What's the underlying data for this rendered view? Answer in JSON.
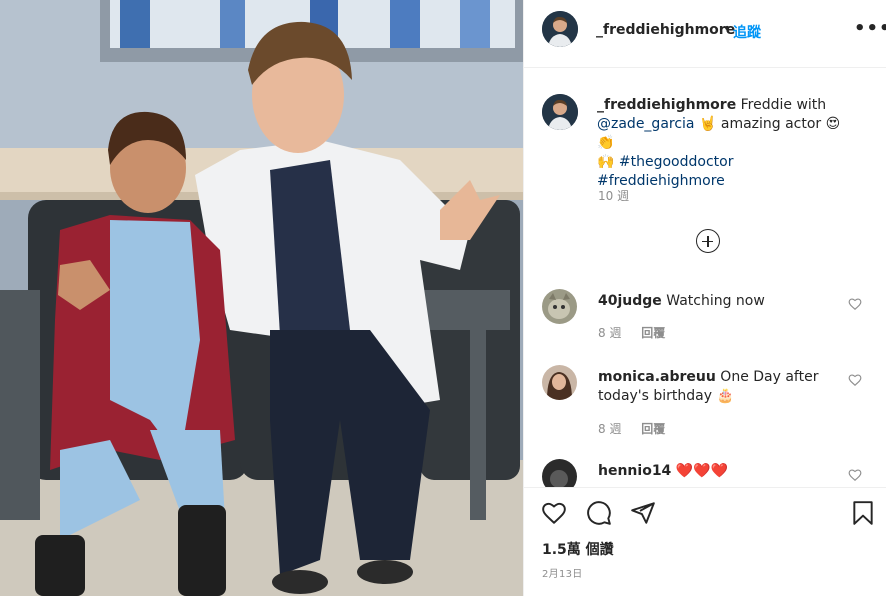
{
  "post": {
    "username": "_freddiehighmore",
    "separator": "•",
    "follow_label": "追蹤",
    "more_label": "•••",
    "caption": {
      "username": "_freddiehighmore",
      "text_1": " Freddie with ",
      "mention": "@zade_garcia",
      "emoji_1": " 🤘 ",
      "text_2": "amazing actor ",
      "emoji_2": "😍👏",
      "emoji_3": "🙌",
      "hashtag_1": "#thegooddoctor",
      "hashtag_2": "#freddiehighmore"
    },
    "caption_time": "10 週",
    "comments": [
      {
        "username": "40judge",
        "text": "Watching now",
        "time": "8 週",
        "reply_label": "回覆"
      },
      {
        "username": "monica.abreuu",
        "text": "One Day after today's birthday 🎂",
        "time": "8 週",
        "reply_label": "回覆"
      },
      {
        "username": "hennio14",
        "text": "❤️❤️❤️"
      }
    ],
    "likes": "1.5萬 個讚",
    "date": "2月13日"
  },
  "colors": {
    "follow": "#0095f6",
    "link": "#00376b",
    "muted": "#8e8e8e"
  }
}
